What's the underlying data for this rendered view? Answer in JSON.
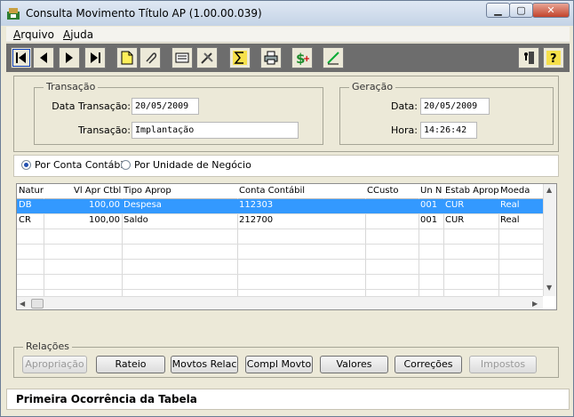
{
  "window": {
    "title": "Consulta Movimento Título AP (1.00.00.039)"
  },
  "menu": {
    "items": [
      {
        "accel": "A",
        "rest": "rquivo"
      },
      {
        "accel": "A",
        "rest": "juda"
      }
    ]
  },
  "transacao": {
    "legend": "Transação",
    "data_label": "Data Transação:",
    "data_value": "20/05/2009",
    "tipo_label": "Transação:",
    "tipo_value": "Implantação"
  },
  "geracao": {
    "legend": "Geração",
    "data_label": "Data:",
    "data_value": "20/05/2009",
    "hora_label": "Hora:",
    "hora_value": "14:26:42"
  },
  "radio": {
    "option1": "Por Conta Contábil",
    "option2": "Por Unidade de Negócio",
    "selected": "option1"
  },
  "grid": {
    "columns": [
      "Natur",
      "Vl Apr Ctbl",
      "Tipo Aprop",
      "Conta Contábil",
      "CCusto",
      "Un N",
      "Estab Aprop",
      "Moeda"
    ],
    "rows": [
      [
        "DB",
        "100,00",
        "Despesa",
        "112303",
        "",
        "001",
        "CUR",
        "Real"
      ],
      [
        "CR",
        "100,00",
        "Saldo",
        "212700",
        "",
        "001",
        "CUR",
        "Real"
      ]
    ]
  },
  "relacoes": {
    "legend": "Relações",
    "buttons": [
      "Apropriação",
      "Rateio",
      "Movtos Relac",
      "Compl Movto",
      "Valores",
      "Correções",
      "Impostos"
    ]
  },
  "status": {
    "text": "Primeira Ocorrência da Tabela"
  },
  "colors": {
    "selection": "#3399ff",
    "toolbar": "#6d6d6d",
    "face": "#ece9d8"
  }
}
